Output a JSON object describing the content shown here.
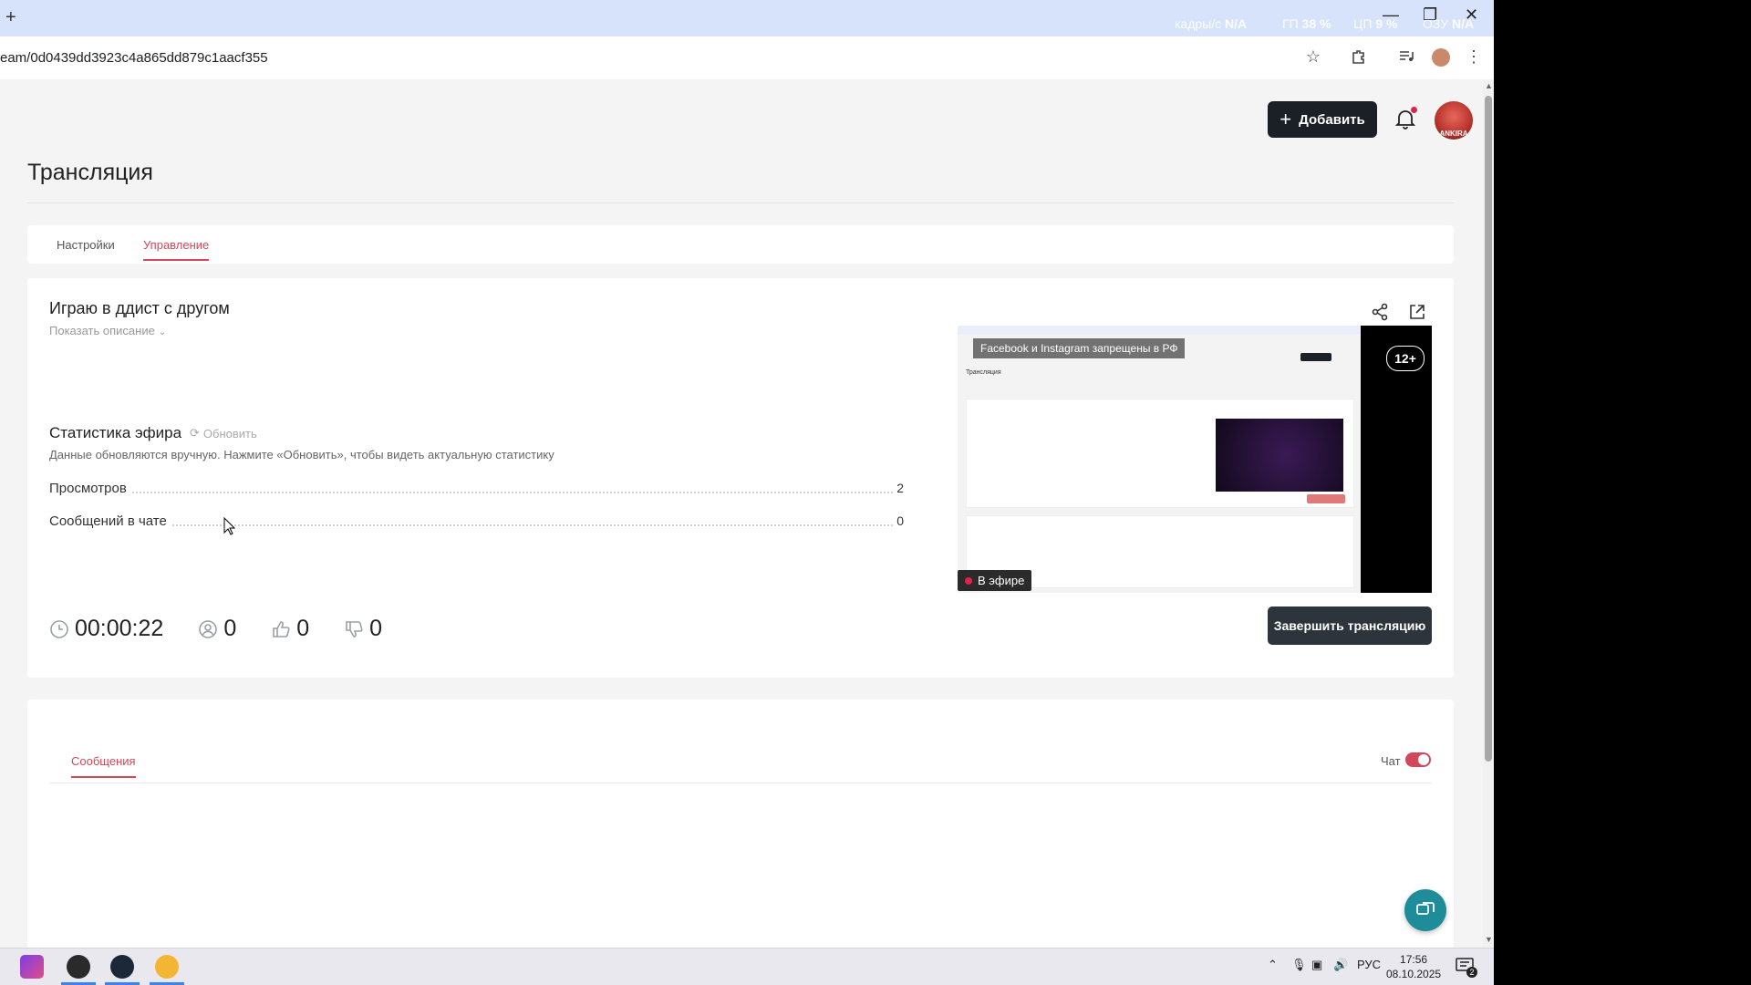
{
  "browser": {
    "new_tab_symbol": "+",
    "url": "eam/0d0439dd3923c4a865dd879c1aacf355",
    "overlay": {
      "fps_label": "кадры/с",
      "fps_value": "N/A",
      "gpu_label": "ГП",
      "gpu_value": "38 %",
      "cpu_label": "ЦП",
      "cpu_value": "9 %",
      "ram_label": "ОЗУ",
      "ram_value": "N/A"
    }
  },
  "header": {
    "add_button": "Добавить",
    "avatar_caption": "ANKIRA"
  },
  "page": {
    "title": "Трансляция",
    "tabs": [
      {
        "label": "Настройки"
      },
      {
        "label": "Управление"
      }
    ]
  },
  "stream": {
    "title": "Играю в ддист с другом",
    "show_description": "Показать описание",
    "stats_title": "Статистика эфира",
    "refresh_label": "Обновить",
    "stats_note": "Данные обновляются вручную. Нажмите «Обновить», чтобы видеть актуальную статистику",
    "rows": [
      {
        "label": "Просмотров",
        "value": "2"
      },
      {
        "label": "Сообщений в чате",
        "value": "0"
      }
    ],
    "metrics": {
      "duration": "00:00:22",
      "viewers": "0",
      "likes": "0",
      "dislikes": "0"
    },
    "preview": {
      "banner": "Facebook и Instagram запрещены в РФ",
      "age_rating": "12+",
      "live_label": "В эфире",
      "mini_title": "Трансляция"
    },
    "end_button": "Завершить трансляцию"
  },
  "messages": {
    "tab_label": "Сообщения",
    "chat_label": "Чат",
    "chat_enabled": true
  },
  "taskbar": {
    "language": "РУС",
    "time": "17:56",
    "date": "08.10.2025",
    "notifications": "2"
  },
  "colors": {
    "accent": "#d2485a",
    "dark_button": "#1b1f26",
    "end_button": "#2d343c",
    "support_fab": "#1f8c9a"
  }
}
